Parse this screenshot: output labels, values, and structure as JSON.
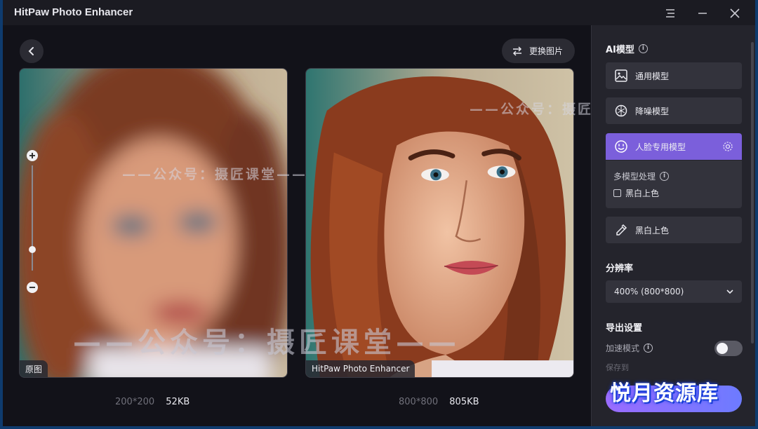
{
  "app": {
    "title": "HitPaw Photo Enhancer"
  },
  "toolbar": {
    "replace_label": "更换图片"
  },
  "preview": {
    "left_tag": "原图",
    "right_tag": "HitPaw Photo Enhancer",
    "left_dims": "200*200",
    "left_size": "52KB",
    "right_dims": "800*800",
    "right_size": "805KB",
    "zoom_level": 0.2
  },
  "watermarks": {
    "small": "——公众号：摄匠课堂——",
    "big": "——公众号：摄匠课堂——"
  },
  "sidebar": {
    "ai_title": "AI模型",
    "models": [
      {
        "label": "通用模型",
        "icon": "image-icon"
      },
      {
        "label": "降噪模型",
        "icon": "denoise-icon"
      },
      {
        "label": "人脸专用模型",
        "icon": "face-icon"
      },
      {
        "label": "黑白上色",
        "icon": "colorize-icon"
      }
    ],
    "multi_label": "多模型处理",
    "multi_option": "黑白上色",
    "resolution_title": "分辨率",
    "resolution_value": "400% (800*800)",
    "export_title": "导出设置",
    "accel_label": "加速模式",
    "faded_label": "保存到",
    "brand_label": "悦月资源库"
  },
  "colors": {
    "accent": "#7b5fdb",
    "panel": "#24242c",
    "bg": "#121219"
  }
}
